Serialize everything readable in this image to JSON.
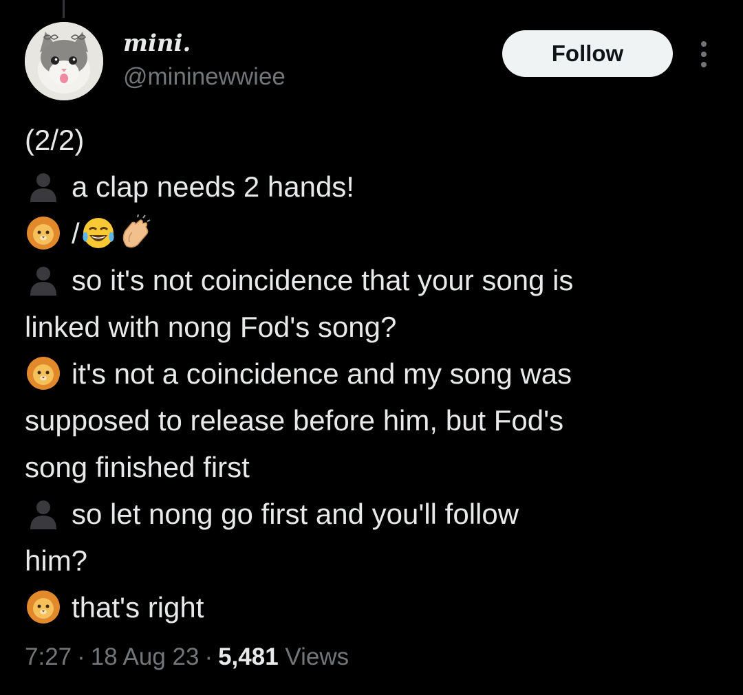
{
  "author": {
    "display_name": "mini.",
    "handle": "@mininewwiee"
  },
  "actions": {
    "follow_label": "Follow"
  },
  "icons": {
    "avatar": "cat-photo-avatar",
    "interviewer": "bust-in-silhouette-icon",
    "singer": "lion-face-icon",
    "laugh": "face-with-tears-of-joy-icon",
    "clap": "clapping-hands-icon",
    "more": "more-options-icon"
  },
  "tweet": {
    "part": "(2/2)",
    "line_1": "a clap needs 2 hands!",
    "line_2_prefix": "/",
    "line_3a": "so it's not coincidence that your song is",
    "line_3b": "linked with nong Fod's song?",
    "line_4a": "it's not a coincidence and my song was",
    "line_4b": "supposed to release before him, but Fod's",
    "line_4c": "song finished first",
    "line_5a": "so let nong go first and you'll follow",
    "line_5b": "him?",
    "line_6": "that's right"
  },
  "meta": {
    "time": "7:27",
    "date": "18 Aug 23",
    "separator": "·",
    "views_count": "5,481",
    "views_label": "Views"
  },
  "colors": {
    "background": "#000000",
    "text_primary": "#e7e9ea",
    "text_secondary": "#71767b",
    "follow_bg": "#eff3f4",
    "follow_text": "#0f1419"
  }
}
